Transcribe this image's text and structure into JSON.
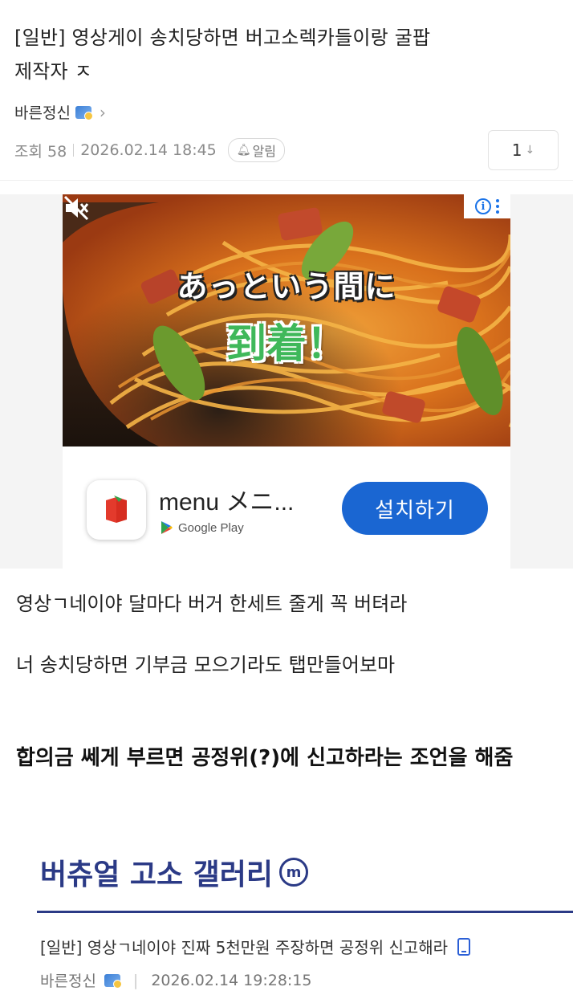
{
  "post": {
    "title": "[일반] 영상게이 송치당하면 버고소렉카들이랑 굴팝제작자 ㅈ",
    "author": "바른정신",
    "views_label": "조회 58",
    "datetime": "2026.02.14 18:45",
    "alarm_label": "알림",
    "comment_count": "1"
  },
  "ad": {
    "headline_line1": "あっという間に",
    "headline_line2": "到着！",
    "app_name": "menu メニ...",
    "store_label": "Google Play",
    "install_label": "설치하기",
    "info_label": "i"
  },
  "body": {
    "line1": "영상ㄱ네이야 달마다 버거 한세트 줄게 꼭 버텨라",
    "line2": "너 송치당하면 기부금 모으기라도 탭만들어보마",
    "line3": "합의금 쎄게 부르면 공정위(?)에 신고하라는 조언을 해줌"
  },
  "gallery": {
    "title": "버츄얼 고소 갤러리",
    "badge": "m",
    "related": {
      "title": "[일반] 영상ㄱ네이야 진짜 5천만원 주장하면 공정위 신고해라",
      "author": "바른정신",
      "datetime": "2026.02.14 19:28:15"
    }
  },
  "icons": [
    "badge-icon",
    "chevron-right-icon",
    "bell-icon",
    "arrow-down-icon",
    "mute-icon",
    "info-icon",
    "kebab-menu-icon",
    "google-play-icon",
    "app-icon",
    "m-badge-icon",
    "mobile-icon"
  ],
  "colors": {
    "install_button": "#1a66d2",
    "gallery_accent": "#2b3a86",
    "headline_green": "#3fb85a"
  }
}
